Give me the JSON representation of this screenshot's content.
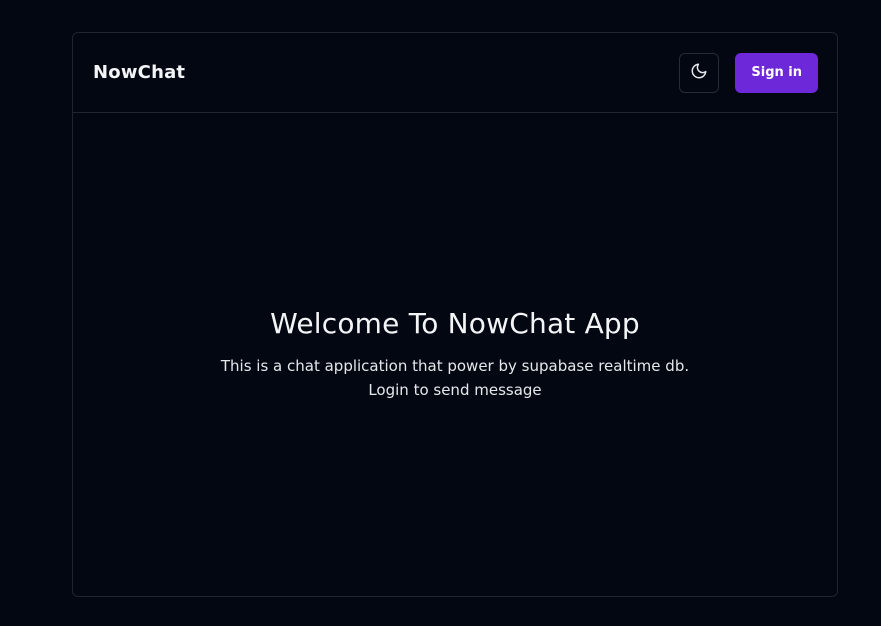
{
  "header": {
    "brand": "NowChat",
    "theme_toggle_icon": "moon-icon",
    "signin_label": "Sign in"
  },
  "main": {
    "title": "Welcome To NowChat App",
    "description": "This is a chat application that power by supabase realtime db. Login to send message"
  },
  "colors": {
    "background": "#030712",
    "border": "#1f2430",
    "accent": "#6d28d9",
    "text": "#f3f4f6"
  }
}
